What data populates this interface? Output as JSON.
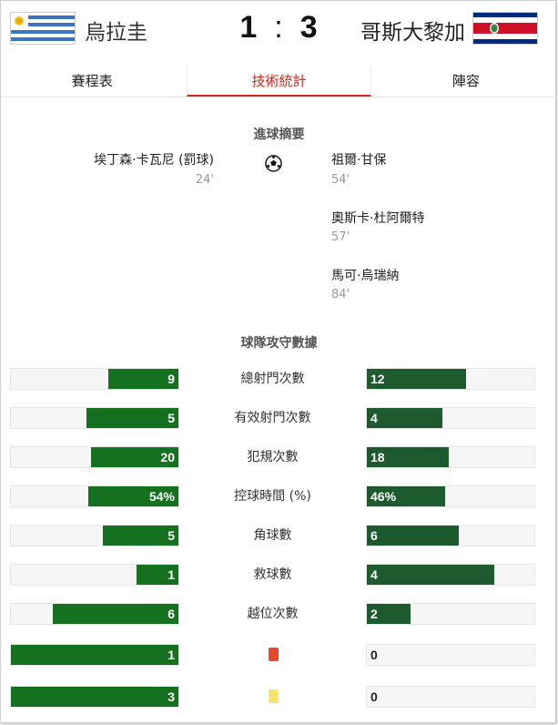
{
  "header": {
    "home_team": "烏拉圭",
    "away_team": "哥斯大黎加",
    "home_score": "1",
    "separator": ":",
    "away_score": "3"
  },
  "tabs": [
    {
      "label": "賽程表"
    },
    {
      "label": "技術統計"
    },
    {
      "label": "陣容"
    }
  ],
  "goals": {
    "title": "進球摘要",
    "home": [
      {
        "player": "埃丁森·卡瓦尼 (罰球)",
        "minute": "24'"
      }
    ],
    "away": [
      {
        "player": "祖爾·甘保",
        "minute": "54'"
      },
      {
        "player": "奧斯卡·杜阿爾特",
        "minute": "57'"
      },
      {
        "player": "馬可·烏瑞納",
        "minute": "84'"
      }
    ]
  },
  "stats": {
    "title": "球隊攻守數據",
    "rows": [
      {
        "label": "總射門次數",
        "home": "9",
        "away": "12",
        "home_frac": 0.42,
        "away_frac": 0.59
      },
      {
        "label": "有效射門次數",
        "home": "5",
        "away": "4",
        "home_frac": 0.55,
        "away_frac": 0.45
      },
      {
        "label": "犯規次數",
        "home": "20",
        "away": "18",
        "home_frac": 0.52,
        "away_frac": 0.49
      },
      {
        "label": "控球時間 (%)",
        "home": "54%",
        "away": "46%",
        "home_frac": 0.54,
        "away_frac": 0.47
      },
      {
        "label": "角球數",
        "home": "5",
        "away": "6",
        "home_frac": 0.45,
        "away_frac": 0.55
      },
      {
        "label": "救球數",
        "home": "1",
        "away": "4",
        "home_frac": 0.25,
        "away_frac": 0.76
      },
      {
        "label": "越位次數",
        "home": "6",
        "away": "2",
        "home_frac": 0.75,
        "away_frac": 0.26
      },
      {
        "label": "",
        "card": "red-card-icon",
        "home": "1",
        "away": "0",
        "home_frac": 1.0,
        "away_frac": 0.0
      },
      {
        "label": "",
        "card": "yellow-card-icon",
        "home": "3",
        "away": "0",
        "home_frac": 1.0,
        "away_frac": 0.0
      }
    ]
  },
  "colors": {
    "accent": "#d9251c",
    "home_bar": "#15701f",
    "away_bar": "#1d5a2e",
    "red_card": "#e8492e",
    "yellow_card": "#f7e26a"
  }
}
